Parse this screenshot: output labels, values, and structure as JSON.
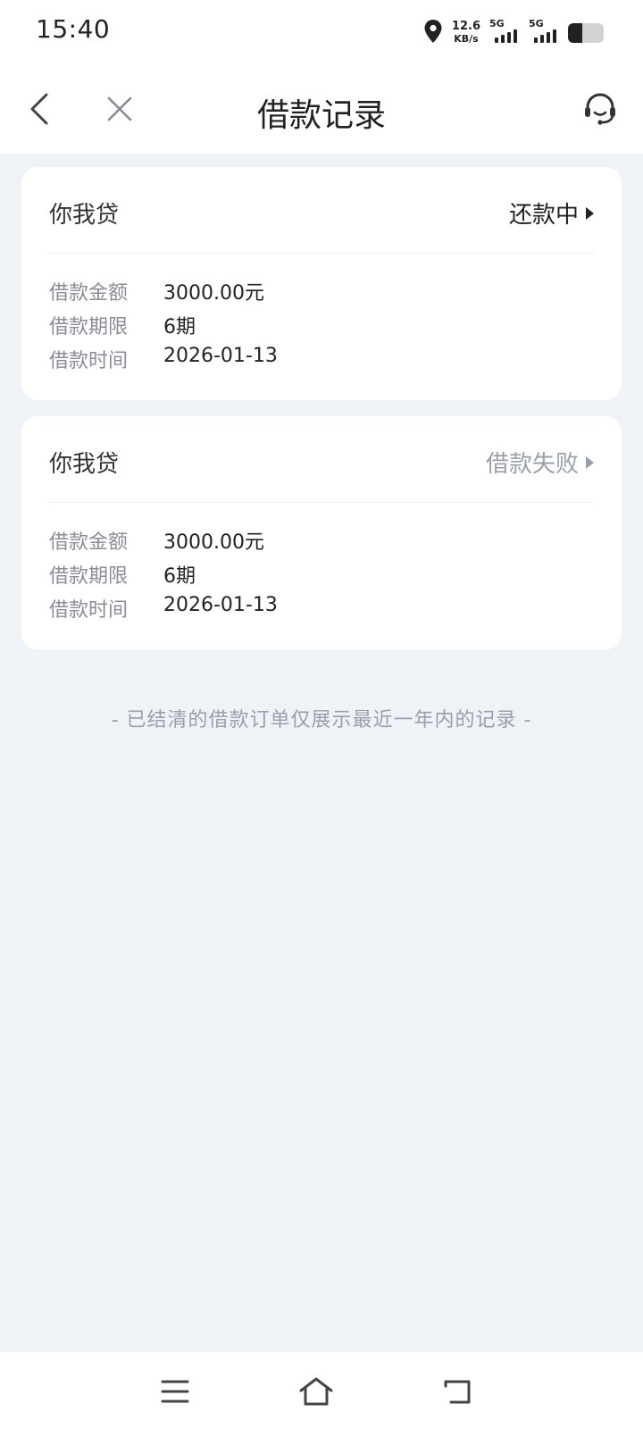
{
  "status_bar": {
    "time": "15:40",
    "net_speed_value": "12.6",
    "net_speed_unit": "KB/s",
    "sim1_label": "5G",
    "sim2_label": "5G",
    "battery_percent": 40
  },
  "header": {
    "title": "借款记录",
    "back_icon": "chevron-left-icon",
    "close_icon": "close-icon",
    "service_icon": "headset-icon"
  },
  "loans": [
    {
      "name": "你我贷",
      "status": "还款中",
      "status_color": "#222222",
      "amount_label": "借款金额",
      "amount": "3000.00元",
      "term_label": "借款期限",
      "term": "6期",
      "date_label": "借款时间",
      "date": "2026-01-13"
    },
    {
      "name": "你我贷",
      "status": "借款失败",
      "status_color": "#9aa0aa",
      "amount_label": "借款金额",
      "amount": "3000.00元",
      "term_label": "借款期限",
      "term": "6期",
      "date_label": "借款时间",
      "date": "2026-01-13"
    }
  ],
  "footer_note": "- 已结清的借款订单仅展示最近一年内的记录 -",
  "nav_bar": {
    "menu_icon": "menu-icon",
    "home_icon": "home-icon",
    "back_icon": "back-icon"
  }
}
